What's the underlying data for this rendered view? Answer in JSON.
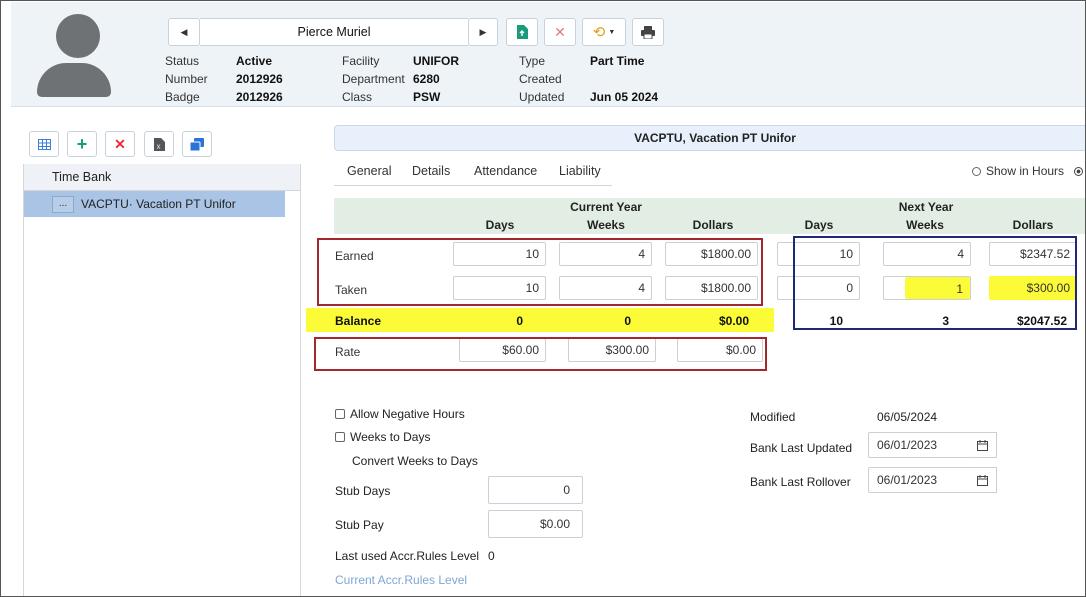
{
  "header": {
    "employee_name": "Pierce Muriel",
    "fields": {
      "status_label": "Status",
      "status_value": "Active",
      "number_label": "Number",
      "number_value": "2012926",
      "badge_label": "Badge",
      "badge_value": "2012926",
      "facility_label": "Facility",
      "facility_value": "UNIFOR",
      "department_label": "Department",
      "department_value": "6280",
      "class_label": "Class",
      "class_value": "PSW",
      "type_label": "Type",
      "type_value": "Part Time",
      "created_label": "Created",
      "created_value": "",
      "updated_label": "Updated",
      "updated_value": "Jun 05 2024"
    }
  },
  "left": {
    "column_header": "Time Bank",
    "rows": [
      {
        "ellipsis": "...",
        "label": "VACPTU· Vacation PT Unifor"
      }
    ]
  },
  "detail": {
    "title": "VACPTU, Vacation PT Unifor",
    "tabs": [
      "General",
      "Details",
      "Attendance",
      "Liability"
    ],
    "show_in_hours": "Show in Hours",
    "groups": {
      "current": "Current Year",
      "next": "Next Year"
    },
    "columns": [
      "Days",
      "Weeks",
      "Dollars",
      "Days",
      "Weeks",
      "Dollars"
    ],
    "rows": {
      "earned": {
        "label": "Earned",
        "values": [
          "10",
          "4",
          "$1800.00",
          "10",
          "4",
          "$2347.52"
        ]
      },
      "taken": {
        "label": "Taken",
        "values": [
          "10",
          "4",
          "$1800.00",
          "0",
          "1",
          "$300.00"
        ]
      },
      "balance": {
        "label": "Balance",
        "values": [
          "0",
          "0",
          "$0.00",
          "10",
          "3",
          "$2047.52"
        ]
      },
      "rate": {
        "label": "Rate",
        "values": [
          "$60.00",
          "$300.00",
          "$0.00"
        ]
      }
    },
    "options": {
      "allow_negative": "Allow Negative Hours",
      "weeks_to_days": "Weeks to Days",
      "convert_weeks": "Convert Weeks to Days"
    },
    "stub_days_label": "Stub Days",
    "stub_days_value": "0",
    "stub_pay_label": "Stub Pay",
    "stub_pay_value": "$0.00",
    "last_used_label": "Last used Accr.Rules Level",
    "last_used_value": "0",
    "current_rules_link": "Current Accr.Rules Level",
    "modified_label": "Modified",
    "modified_value": "06/05/2024",
    "bank_last_updated_label": "Bank Last Updated",
    "bank_last_updated_value": "06/01/2023",
    "bank_last_rollover_label": "Bank Last Rollover",
    "bank_last_rollover_value": "06/01/2023"
  },
  "colors": {
    "highlight": "#fbfb37",
    "annotation_red": "#a3282c",
    "annotation_blue": "#1e2a78",
    "accent_green": "#1a9b7a",
    "delete_red": "#e0303a"
  }
}
